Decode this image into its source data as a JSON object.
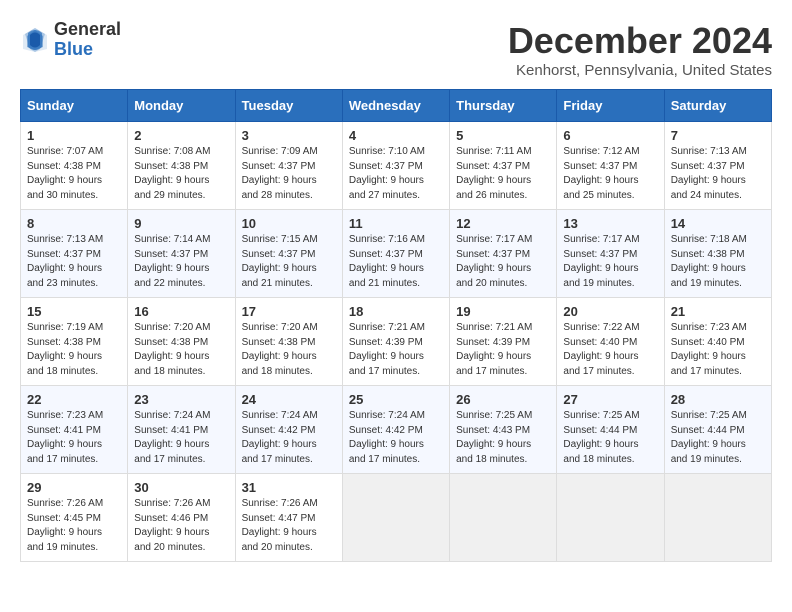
{
  "header": {
    "logo_general": "General",
    "logo_blue": "Blue",
    "month": "December 2024",
    "location": "Kenhorst, Pennsylvania, United States"
  },
  "days_of_week": [
    "Sunday",
    "Monday",
    "Tuesday",
    "Wednesday",
    "Thursday",
    "Friday",
    "Saturday"
  ],
  "weeks": [
    [
      {
        "day": "1",
        "sunrise": "Sunrise: 7:07 AM",
        "sunset": "Sunset: 4:38 PM",
        "daylight": "Daylight: 9 hours and 30 minutes."
      },
      {
        "day": "2",
        "sunrise": "Sunrise: 7:08 AM",
        "sunset": "Sunset: 4:38 PM",
        "daylight": "Daylight: 9 hours and 29 minutes."
      },
      {
        "day": "3",
        "sunrise": "Sunrise: 7:09 AM",
        "sunset": "Sunset: 4:37 PM",
        "daylight": "Daylight: 9 hours and 28 minutes."
      },
      {
        "day": "4",
        "sunrise": "Sunrise: 7:10 AM",
        "sunset": "Sunset: 4:37 PM",
        "daylight": "Daylight: 9 hours and 27 minutes."
      },
      {
        "day": "5",
        "sunrise": "Sunrise: 7:11 AM",
        "sunset": "Sunset: 4:37 PM",
        "daylight": "Daylight: 9 hours and 26 minutes."
      },
      {
        "day": "6",
        "sunrise": "Sunrise: 7:12 AM",
        "sunset": "Sunset: 4:37 PM",
        "daylight": "Daylight: 9 hours and 25 minutes."
      },
      {
        "day": "7",
        "sunrise": "Sunrise: 7:13 AM",
        "sunset": "Sunset: 4:37 PM",
        "daylight": "Daylight: 9 hours and 24 minutes."
      }
    ],
    [
      {
        "day": "8",
        "sunrise": "Sunrise: 7:13 AM",
        "sunset": "Sunset: 4:37 PM",
        "daylight": "Daylight: 9 hours and 23 minutes."
      },
      {
        "day": "9",
        "sunrise": "Sunrise: 7:14 AM",
        "sunset": "Sunset: 4:37 PM",
        "daylight": "Daylight: 9 hours and 22 minutes."
      },
      {
        "day": "10",
        "sunrise": "Sunrise: 7:15 AM",
        "sunset": "Sunset: 4:37 PM",
        "daylight": "Daylight: 9 hours and 21 minutes."
      },
      {
        "day": "11",
        "sunrise": "Sunrise: 7:16 AM",
        "sunset": "Sunset: 4:37 PM",
        "daylight": "Daylight: 9 hours and 21 minutes."
      },
      {
        "day": "12",
        "sunrise": "Sunrise: 7:17 AM",
        "sunset": "Sunset: 4:37 PM",
        "daylight": "Daylight: 9 hours and 20 minutes."
      },
      {
        "day": "13",
        "sunrise": "Sunrise: 7:17 AM",
        "sunset": "Sunset: 4:37 PM",
        "daylight": "Daylight: 9 hours and 19 minutes."
      },
      {
        "day": "14",
        "sunrise": "Sunrise: 7:18 AM",
        "sunset": "Sunset: 4:38 PM",
        "daylight": "Daylight: 9 hours and 19 minutes."
      }
    ],
    [
      {
        "day": "15",
        "sunrise": "Sunrise: 7:19 AM",
        "sunset": "Sunset: 4:38 PM",
        "daylight": "Daylight: 9 hours and 18 minutes."
      },
      {
        "day": "16",
        "sunrise": "Sunrise: 7:20 AM",
        "sunset": "Sunset: 4:38 PM",
        "daylight": "Daylight: 9 hours and 18 minutes."
      },
      {
        "day": "17",
        "sunrise": "Sunrise: 7:20 AM",
        "sunset": "Sunset: 4:38 PM",
        "daylight": "Daylight: 9 hours and 18 minutes."
      },
      {
        "day": "18",
        "sunrise": "Sunrise: 7:21 AM",
        "sunset": "Sunset: 4:39 PM",
        "daylight": "Daylight: 9 hours and 17 minutes."
      },
      {
        "day": "19",
        "sunrise": "Sunrise: 7:21 AM",
        "sunset": "Sunset: 4:39 PM",
        "daylight": "Daylight: 9 hours and 17 minutes."
      },
      {
        "day": "20",
        "sunrise": "Sunrise: 7:22 AM",
        "sunset": "Sunset: 4:40 PM",
        "daylight": "Daylight: 9 hours and 17 minutes."
      },
      {
        "day": "21",
        "sunrise": "Sunrise: 7:23 AM",
        "sunset": "Sunset: 4:40 PM",
        "daylight": "Daylight: 9 hours and 17 minutes."
      }
    ],
    [
      {
        "day": "22",
        "sunrise": "Sunrise: 7:23 AM",
        "sunset": "Sunset: 4:41 PM",
        "daylight": "Daylight: 9 hours and 17 minutes."
      },
      {
        "day": "23",
        "sunrise": "Sunrise: 7:24 AM",
        "sunset": "Sunset: 4:41 PM",
        "daylight": "Daylight: 9 hours and 17 minutes."
      },
      {
        "day": "24",
        "sunrise": "Sunrise: 7:24 AM",
        "sunset": "Sunset: 4:42 PM",
        "daylight": "Daylight: 9 hours and 17 minutes."
      },
      {
        "day": "25",
        "sunrise": "Sunrise: 7:24 AM",
        "sunset": "Sunset: 4:42 PM",
        "daylight": "Daylight: 9 hours and 17 minutes."
      },
      {
        "day": "26",
        "sunrise": "Sunrise: 7:25 AM",
        "sunset": "Sunset: 4:43 PM",
        "daylight": "Daylight: 9 hours and 18 minutes."
      },
      {
        "day": "27",
        "sunrise": "Sunrise: 7:25 AM",
        "sunset": "Sunset: 4:44 PM",
        "daylight": "Daylight: 9 hours and 18 minutes."
      },
      {
        "day": "28",
        "sunrise": "Sunrise: 7:25 AM",
        "sunset": "Sunset: 4:44 PM",
        "daylight": "Daylight: 9 hours and 19 minutes."
      }
    ],
    [
      {
        "day": "29",
        "sunrise": "Sunrise: 7:26 AM",
        "sunset": "Sunset: 4:45 PM",
        "daylight": "Daylight: 9 hours and 19 minutes."
      },
      {
        "day": "30",
        "sunrise": "Sunrise: 7:26 AM",
        "sunset": "Sunset: 4:46 PM",
        "daylight": "Daylight: 9 hours and 20 minutes."
      },
      {
        "day": "31",
        "sunrise": "Sunrise: 7:26 AM",
        "sunset": "Sunset: 4:47 PM",
        "daylight": "Daylight: 9 hours and 20 minutes."
      },
      null,
      null,
      null,
      null
    ]
  ]
}
